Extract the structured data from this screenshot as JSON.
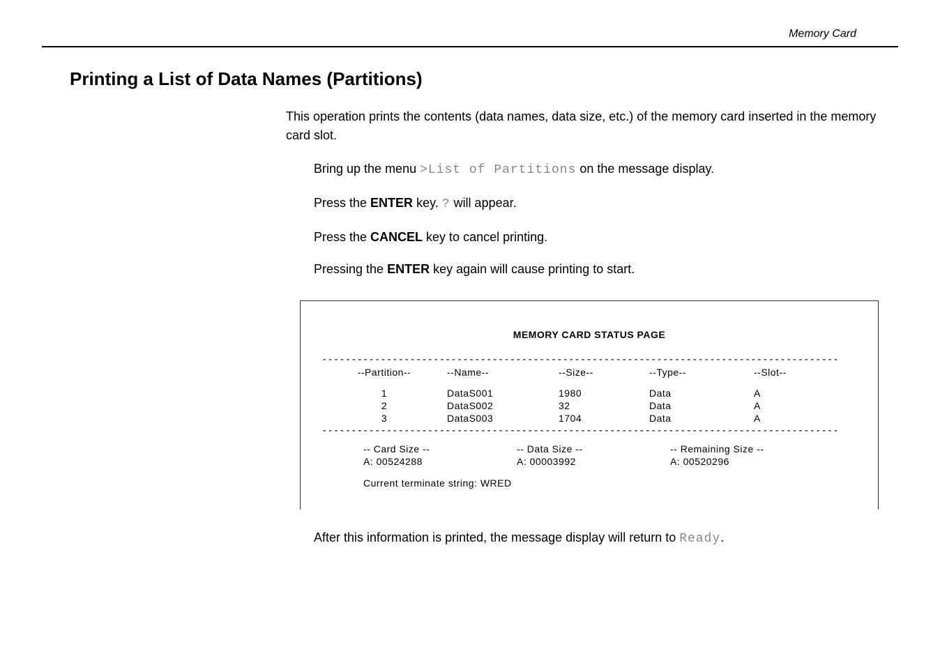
{
  "header": {
    "running_title": "Memory Card"
  },
  "heading": "Printing a List of Data Names (Partitions)",
  "intro": "This operation prints the contents (data names, data size, etc.) of the memory card inserted in the memory card slot.",
  "steps": {
    "s1_pre": "Bring up the menu ",
    "s1_code": ">List of Partitions",
    "s1_post": " on the message display.",
    "s2_pre": "Press the ",
    "s2_bold": "ENTER",
    "s2_mid": " key. ",
    "s2_code": "?",
    "s2_post": " will appear.",
    "s3_pre": "Press the ",
    "s3_bold": "CANCEL",
    "s3_post": " key to cancel printing.",
    "s4_pre": "Pressing the ",
    "s4_bold": "ENTER",
    "s4_post": " key again will cause printing to start."
  },
  "printout": {
    "title": "MEMORY CARD   STATUS   PAGE",
    "dashes": "----------------------------------------------------------------------------------------",
    "headers": {
      "partition": "--Partition--",
      "name": "--Name--",
      "size": "--Size--",
      "type": "--Type--",
      "slot": "--Slot--"
    },
    "rows": [
      {
        "partition": "1",
        "name": "DataS001",
        "size": "1980",
        "type": "Data",
        "slot": "A"
      },
      {
        "partition": "2",
        "name": "DataS002",
        "size": "32",
        "type": "Data",
        "slot": "A"
      },
      {
        "partition": "3",
        "name": "DataS003",
        "size": "1704",
        "type": "Data",
        "slot": "A"
      }
    ],
    "summary_labels": {
      "card": "-- Card Size --",
      "data": "-- Data Size --",
      "remaining": "-- Remaining Size --"
    },
    "summary_values": {
      "card": "A: 00524288",
      "data": "A: 00003992",
      "remaining": "A: 00520296"
    },
    "terminate": "Current terminate string: WRED"
  },
  "footer": {
    "pre": "After this information is printed, the message display will return to ",
    "code": "Ready",
    "post": "."
  }
}
